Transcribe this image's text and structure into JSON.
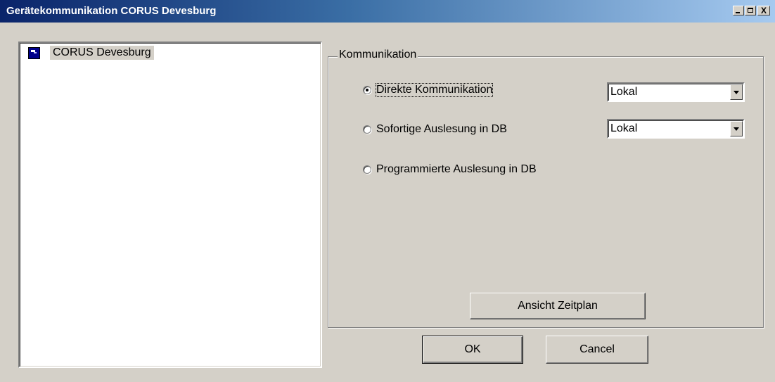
{
  "window": {
    "title": "Gerätekommunikation CORUS Devesburg",
    "minimize_icon": "minimize-icon",
    "maximize_icon": "maximize-icon",
    "close_glyph": "X"
  },
  "tree": {
    "items": [
      {
        "label": "CORUS Devesburg",
        "icon": "device-icon"
      }
    ]
  },
  "group": {
    "legend": "Kommunikation",
    "options": [
      {
        "label": "Direkte Kommunikation",
        "checked": true
      },
      {
        "label": "Sofortige Auslesung in DB",
        "checked": false
      },
      {
        "label": "Programmierte Auslesung in DB",
        "checked": false
      }
    ],
    "combos": [
      {
        "value": "Lokal"
      },
      {
        "value": "Lokal"
      }
    ],
    "schedule_button": "Ansicht Zeitplan"
  },
  "buttons": {
    "ok": "OK",
    "cancel": "Cancel"
  },
  "colors": {
    "title_start": "#0a246a",
    "title_end": "#a6caf0",
    "face": "#d4d0c8"
  }
}
